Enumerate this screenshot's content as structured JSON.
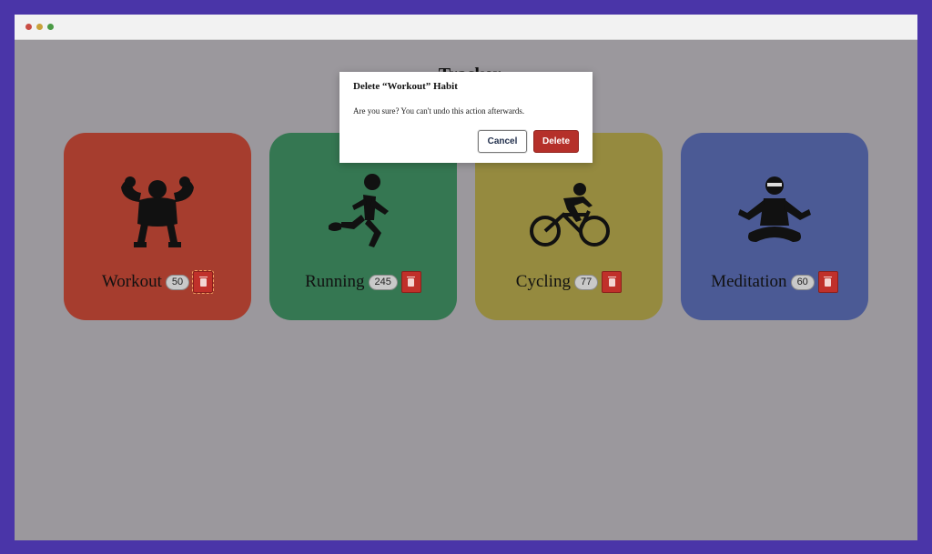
{
  "page": {
    "heading": "Tracker"
  },
  "cards": [
    {
      "name": "Workout",
      "count": "50",
      "color": "#a63d2e",
      "icon": "bodybuilder-icon"
    },
    {
      "name": "Running",
      "count": "245",
      "color": "#357752",
      "icon": "runner-icon"
    },
    {
      "name": "Cycling",
      "count": "77",
      "color": "#958a3f",
      "icon": "cyclist-icon"
    },
    {
      "name": "Meditation",
      "count": "60",
      "color": "#4b5a95",
      "icon": "meditation-icon"
    }
  ],
  "dialog": {
    "title": "Delete “Workout” Habit",
    "message": "Are you sure? You can't undo this action afterwards.",
    "cancel_label": "Cancel",
    "delete_label": "Delete"
  },
  "colors": {
    "background": "#4a35a8",
    "overlay": "#9b989d",
    "delete_red": "#b5302a"
  }
}
